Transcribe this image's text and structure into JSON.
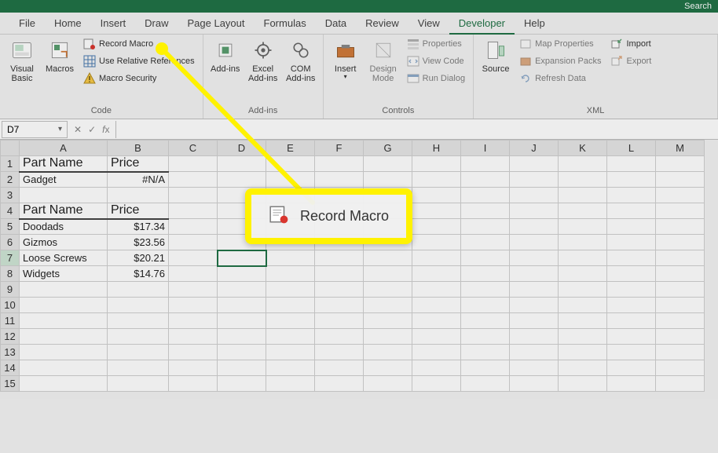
{
  "title_bar": {
    "search_label": "Search"
  },
  "tabs": [
    "File",
    "Home",
    "Insert",
    "Draw",
    "Page Layout",
    "Formulas",
    "Data",
    "Review",
    "View",
    "Developer",
    "Help"
  ],
  "active_tab": "Developer",
  "ribbon": {
    "code": {
      "label": "Code",
      "visual_basic": "Visual Basic",
      "macros": "Macros",
      "record_macro": "Record Macro",
      "use_relative": "Use Relative References",
      "macro_security": "Macro Security"
    },
    "addins": {
      "label": "Add-ins",
      "addins": "Add-ins",
      "excel_addins": "Excel Add-ins",
      "com_addins": "COM Add-ins"
    },
    "controls": {
      "label": "Controls",
      "insert": "Insert",
      "design_mode": "Design Mode",
      "properties": "Properties",
      "view_code": "View Code",
      "run_dialog": "Run Dialog"
    },
    "xml": {
      "label": "XML",
      "source": "Source",
      "map_props": "Map Properties",
      "expansion": "Expansion Packs",
      "refresh": "Refresh Data",
      "import": "Import",
      "export": "Export"
    }
  },
  "name_box": "D7",
  "formula_bar": "",
  "columns": [
    "A",
    "B",
    "C",
    "D",
    "E",
    "F",
    "G",
    "H",
    "I",
    "J",
    "K",
    "L",
    "M"
  ],
  "rows": [
    1,
    2,
    3,
    4,
    5,
    6,
    7,
    8,
    9,
    10,
    11,
    12,
    13,
    14,
    15
  ],
  "cells": {
    "A1": "Part Name",
    "B1": "Price",
    "A2": "Gadget",
    "B2": "#N/A",
    "A4": "Part Name",
    "B4": "Price",
    "A5": "Doodads",
    "B5": "$17.34",
    "A6": "Gizmos",
    "B6": "$23.56",
    "A7": "Loose Screws",
    "B7": "$20.21",
    "A8": "Widgets",
    "B8": "$14.76"
  },
  "selected_cell": "D7",
  "callout": {
    "label": "Record Macro"
  }
}
